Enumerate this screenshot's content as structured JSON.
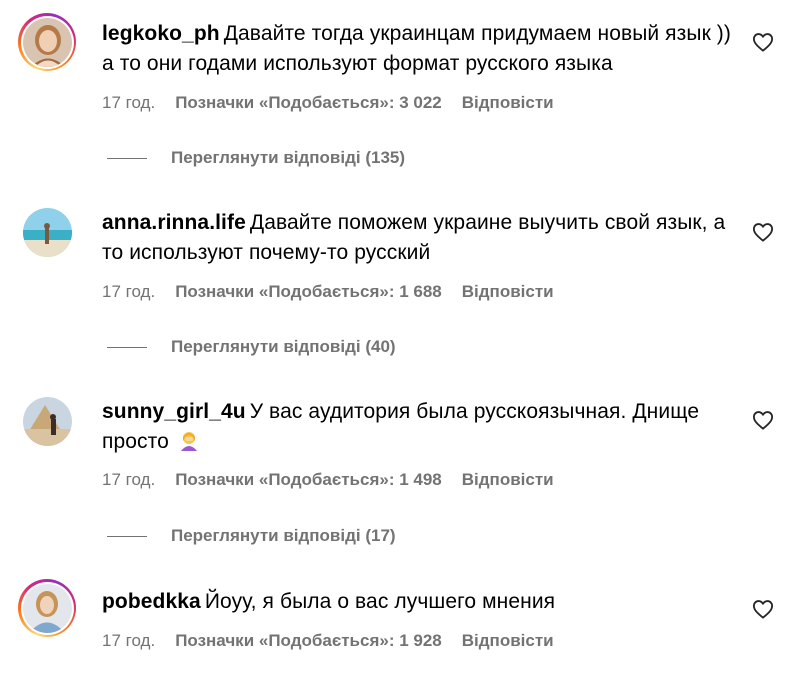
{
  "comments": [
    {
      "username": "legkoko_ph",
      "text": "Давайте тогда украинцам придумаем новый язык )) а то они годами используют формат русского языка",
      "time": "17 год.",
      "likes": "Позначки «Подобається»: 3 022",
      "reply_label": "Відповісти",
      "view_replies": "Переглянути відповіді (135)",
      "has_story": true
    },
    {
      "username": "anna.rinna.life",
      "text": "Давайте поможем украине выучить свой язык, а то используют почему-то русский",
      "time": "17 год.",
      "likes": "Позначки «Подобається»: 1 688",
      "reply_label": "Відповісти",
      "view_replies": "Переглянути відповіді (40)",
      "has_story": false
    },
    {
      "username": "sunny_girl_4u",
      "text": "У вас аудитория была русскоязычная. Днище просто",
      "emoji": "🤦‍♀️",
      "time": "17 год.",
      "likes": "Позначки «Подобається»: 1 498",
      "reply_label": "Відповісти",
      "view_replies": "Переглянути відповіді (17)",
      "has_story": false
    },
    {
      "username": "pobedkka",
      "text": "Йоуу, я была о вас лучшего мнения",
      "time": "17 год.",
      "likes": "Позначки «Подобається»: 1 928",
      "reply_label": "Відповісти",
      "has_story": true
    }
  ],
  "icons": {
    "like": "heart-outline-icon",
    "facepalm": "woman-facepalming-emoji"
  },
  "colors": {
    "secondary_text": "#737373",
    "primary_text": "#000000",
    "story_ring": [
      "#feda75",
      "#fa7e1e",
      "#d62976",
      "#962fbf"
    ]
  }
}
